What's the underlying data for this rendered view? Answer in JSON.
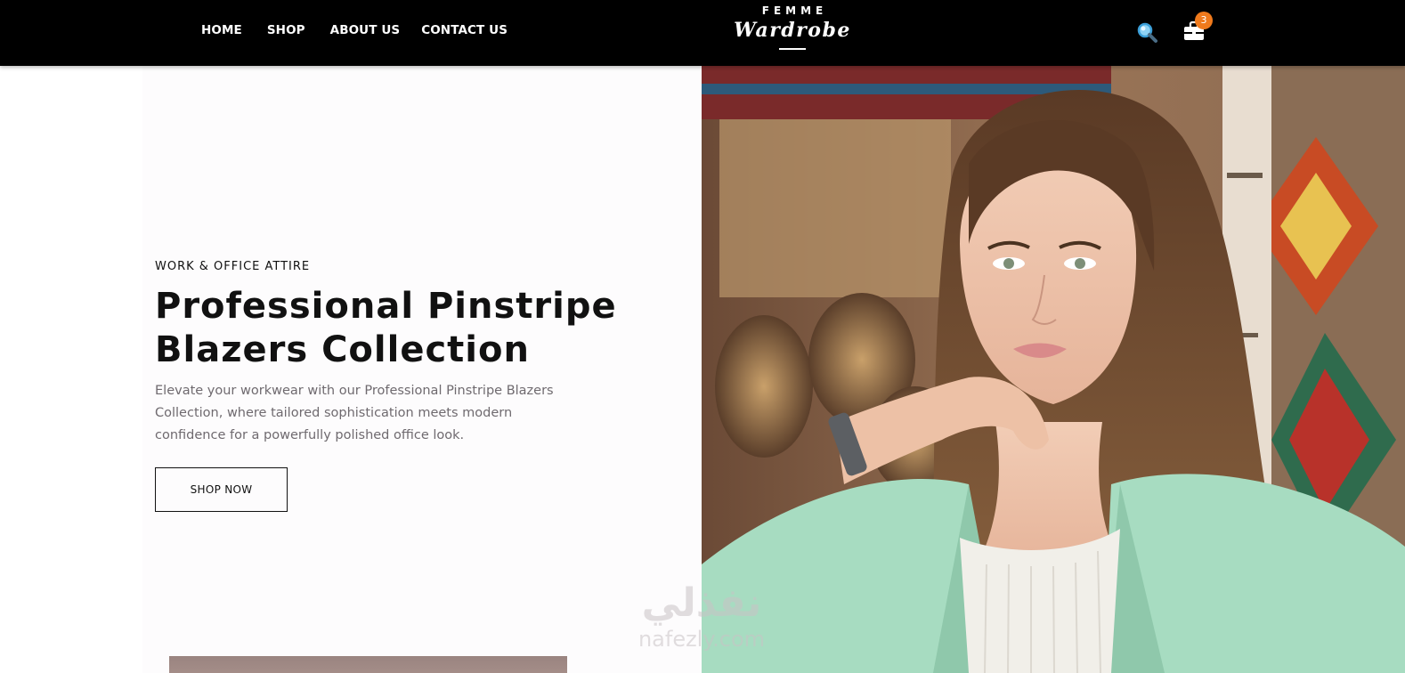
{
  "nav": {
    "home": "HOME",
    "shop": "SHOP",
    "about": "ABOUT US",
    "contact": "CONTACT US"
  },
  "logo": {
    "top": "FEMME",
    "main": "Wardrobe"
  },
  "header_icons": {
    "search": "search-icon",
    "cart": "cart-icon",
    "cart_count": "3"
  },
  "hero": {
    "eyebrow": "WORK & OFFICE ATTIRE",
    "title_line1": "Professional Pinstripe",
    "title_line2": "Blazers Collection",
    "description": "Elevate your workwear with our Professional Pinstripe Blazers Collection, where tailored sophistication meets modern confidence for a powerfully polished office look.",
    "button": "SHOP NOW"
  },
  "watermark": {
    "arabic": "نفذلي",
    "latin": "nafezly.com"
  },
  "colors": {
    "header_bg": "#000000",
    "badge": "#f07a1c",
    "text_dark": "#111111",
    "text_muted": "#6f6a6f",
    "blazer": "#a7dcc1"
  }
}
